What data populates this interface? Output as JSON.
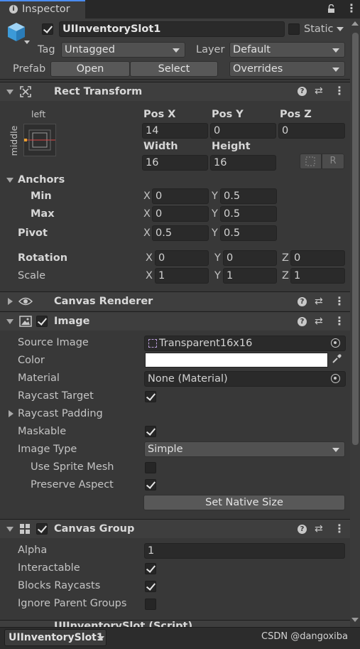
{
  "tab": {
    "icon": "info-icon",
    "label": "Inspector"
  },
  "object": {
    "name": "UIInventorySlot1",
    "static_label": "Static",
    "tag_label": "Tag",
    "tag_value": "Untagged",
    "layer_label": "Layer",
    "layer_value": "Default",
    "prefab_label": "Prefab",
    "open_label": "Open",
    "select_label": "Select",
    "overrides_label": "Overrides"
  },
  "rect_transform": {
    "title": "Rect Transform",
    "anchor_top_label": "left",
    "anchor_side_label": "middle",
    "pos_x_label": "Pos X",
    "pos_y_label": "Pos Y",
    "pos_z_label": "Pos Z",
    "pos_x": "14",
    "pos_y": "0",
    "pos_z": "0",
    "width_label": "Width",
    "height_label": "Height",
    "width": "16",
    "height": "16",
    "raw_button_label": "R",
    "anchors_label": "Anchors",
    "min_label": "Min",
    "min_x": "0",
    "min_y": "0.5",
    "max_label": "Max",
    "max_x": "0",
    "max_y": "0.5",
    "pivot_label": "Pivot",
    "pivot_x": "0.5",
    "pivot_y": "0.5",
    "rotation_label": "Rotation",
    "rot_x": "0",
    "rot_y": "0",
    "rot_z": "0",
    "scale_label": "Scale",
    "scale_x": "1",
    "scale_y": "1",
    "scale_z": "1",
    "x": "X",
    "y": "Y",
    "z": "Z"
  },
  "canvas_renderer": {
    "title": "Canvas Renderer"
  },
  "image": {
    "title": "Image",
    "source_image_label": "Source Image",
    "source_image_value": "Transparent16x16",
    "color_label": "Color",
    "color_value": "#ffffff",
    "material_label": "Material",
    "material_value": "None (Material)",
    "raycast_target_label": "Raycast Target",
    "raycast_target": true,
    "raycast_padding_label": "Raycast Padding",
    "maskable_label": "Maskable",
    "maskable": true,
    "image_type_label": "Image Type",
    "image_type_value": "Simple",
    "use_sprite_mesh_label": "Use Sprite Mesh",
    "use_sprite_mesh": false,
    "preserve_aspect_label": "Preserve Aspect",
    "preserve_aspect": true,
    "set_native_size_label": "Set Native Size"
  },
  "canvas_group": {
    "title": "Canvas Group",
    "alpha_label": "Alpha",
    "alpha_value": "1",
    "interactable_label": "Interactable",
    "interactable": true,
    "blocks_raycasts_label": "Blocks Raycasts",
    "blocks_raycasts": true,
    "ignore_parent_groups_label": "Ignore Parent Groups",
    "ignore_parent_groups": false
  },
  "next_component": {
    "title": "UIInventorySlot (Script)"
  },
  "footer": {
    "selection_label": "UIInventorySlot1",
    "watermark": "CSDN @dangoxiba"
  },
  "colors": {
    "background": "#383838",
    "header": "#3e3e3e",
    "field": "#2a2a2a",
    "tab": "#3c3c3c"
  }
}
